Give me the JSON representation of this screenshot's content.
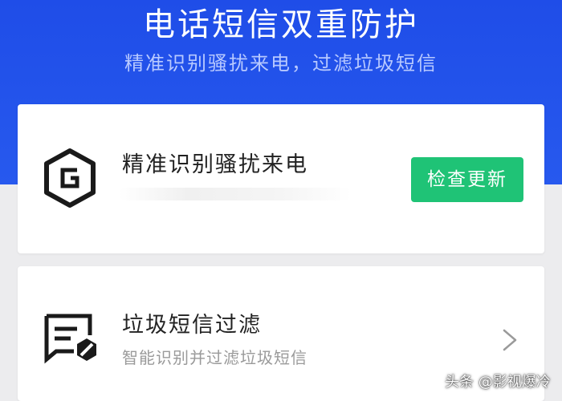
{
  "header": {
    "title": "电话短信双重防护",
    "subtitle": "精准识别骚扰来电，过滤垃圾短信"
  },
  "cards": [
    {
      "title": "精准识别骚扰来电",
      "icon": "hexagon-g-shield-icon",
      "button_label": "检查更新"
    },
    {
      "title": "垃圾短信过滤",
      "description": "智能识别并过滤垃圾短信",
      "icon": "spam-message-filter-icon",
      "action_icon": "chevron-right-icon"
    }
  ],
  "watermark": {
    "text": "头条 @影视爆冷"
  },
  "colors": {
    "header_blue": "#2759ee",
    "button_green": "#1fc376",
    "page_background": "#ececee"
  }
}
